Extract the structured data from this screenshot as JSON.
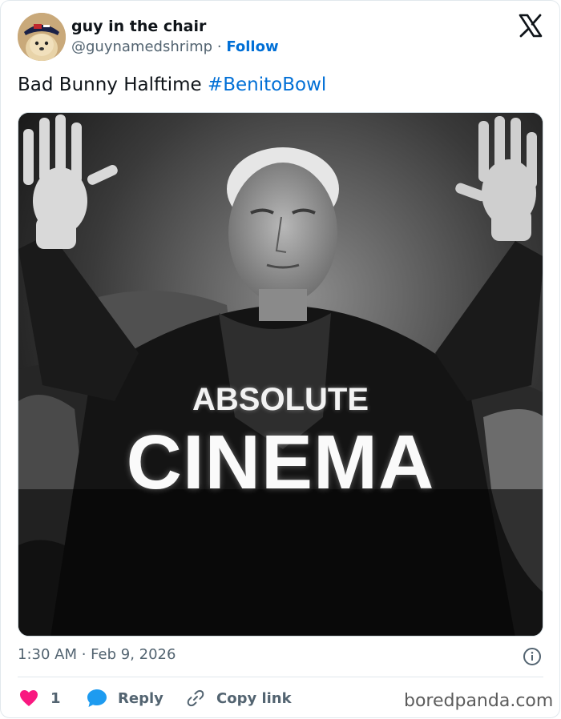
{
  "author": {
    "display_name": "guy in the chair",
    "handle": "@guynamedshrimp",
    "separator": "·",
    "follow_label": "Follow"
  },
  "tweet": {
    "text": "Bad Bunny Halftime",
    "hashtag": "#BenitoBowl",
    "media_alt": "Black-and-white photo of an older man seated in an armchair with both hands raised",
    "media_caption_line1": "ABSOLUTE",
    "media_caption_line2": "CINEMA",
    "timestamp": "1:30 AM · Feb 9, 2026"
  },
  "actions": {
    "like_count": "1",
    "reply_label": "Reply",
    "copy_link_label": "Copy link"
  },
  "watermark": "boredpanda.com",
  "icons": {
    "brand": "x-logo-icon",
    "like": "heart-icon",
    "reply": "speech-bubble-icon",
    "copy": "link-icon",
    "info": "info-icon"
  },
  "colors": {
    "link_blue": "#006fd6",
    "like_red": "#f91880",
    "reply_blue": "#1d9bf0",
    "muted_gray": "#536471",
    "text": "#0f1419"
  }
}
